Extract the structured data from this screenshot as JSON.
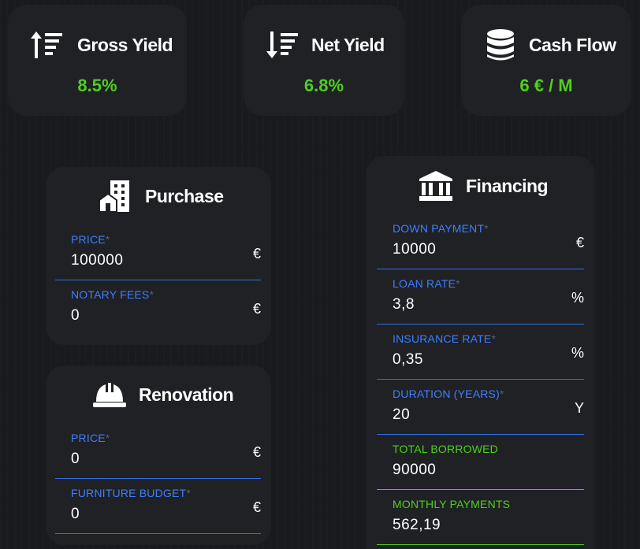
{
  "stats": {
    "gross_yield": {
      "label": "Gross Yield",
      "value": "8.5%",
      "icon": "sort-amount-up-icon"
    },
    "net_yield": {
      "label": "Net Yield",
      "value": "6.8%",
      "icon": "sort-amount-down-icon"
    },
    "cash_flow": {
      "label": "Cash Flow",
      "value": "6 € / M",
      "icon": "database-icon"
    }
  },
  "purchase": {
    "title": "Purchase",
    "icon": "building-icon",
    "price": {
      "label": "PRICE",
      "required": "*",
      "value": "100000",
      "unit": "€"
    },
    "notary_fees": {
      "label": "NOTARY FEES",
      "required": "*",
      "value": "0",
      "unit": "€"
    }
  },
  "renovation": {
    "title": "Renovation",
    "icon": "hard-hat-icon",
    "price": {
      "label": "PRICE",
      "required": "*",
      "value": "0",
      "unit": "€"
    },
    "furniture_budget": {
      "label": "FURNITURE BUDGET",
      "required": "*",
      "value": "0",
      "unit": "€"
    }
  },
  "financing": {
    "title": "Financing",
    "icon": "bank-icon",
    "down_payment": {
      "label": "DOWN PAYMENT",
      "required": "*",
      "value": "10000",
      "unit": "€"
    },
    "loan_rate": {
      "label": "LOAN RATE",
      "required": "*",
      "value": "3,8",
      "unit": "%"
    },
    "insurance_rate": {
      "label": "INSURANCE RATE",
      "required": "*",
      "value": "0,35",
      "unit": "%"
    },
    "duration": {
      "label": "DURATION (YEARS)",
      "required": "*",
      "value": "20",
      "unit": "Y"
    },
    "total_borrowed": {
      "label": "TOTAL BORROWED",
      "value": "90000"
    },
    "monthly_payments": {
      "label": "MONTHLY PAYMENTS",
      "value": "562,19"
    }
  },
  "colors": {
    "background": "#181a1e",
    "card": "#1f2125",
    "accent_blue": "#3f7fff",
    "accent_green": "#4fcf1f"
  }
}
